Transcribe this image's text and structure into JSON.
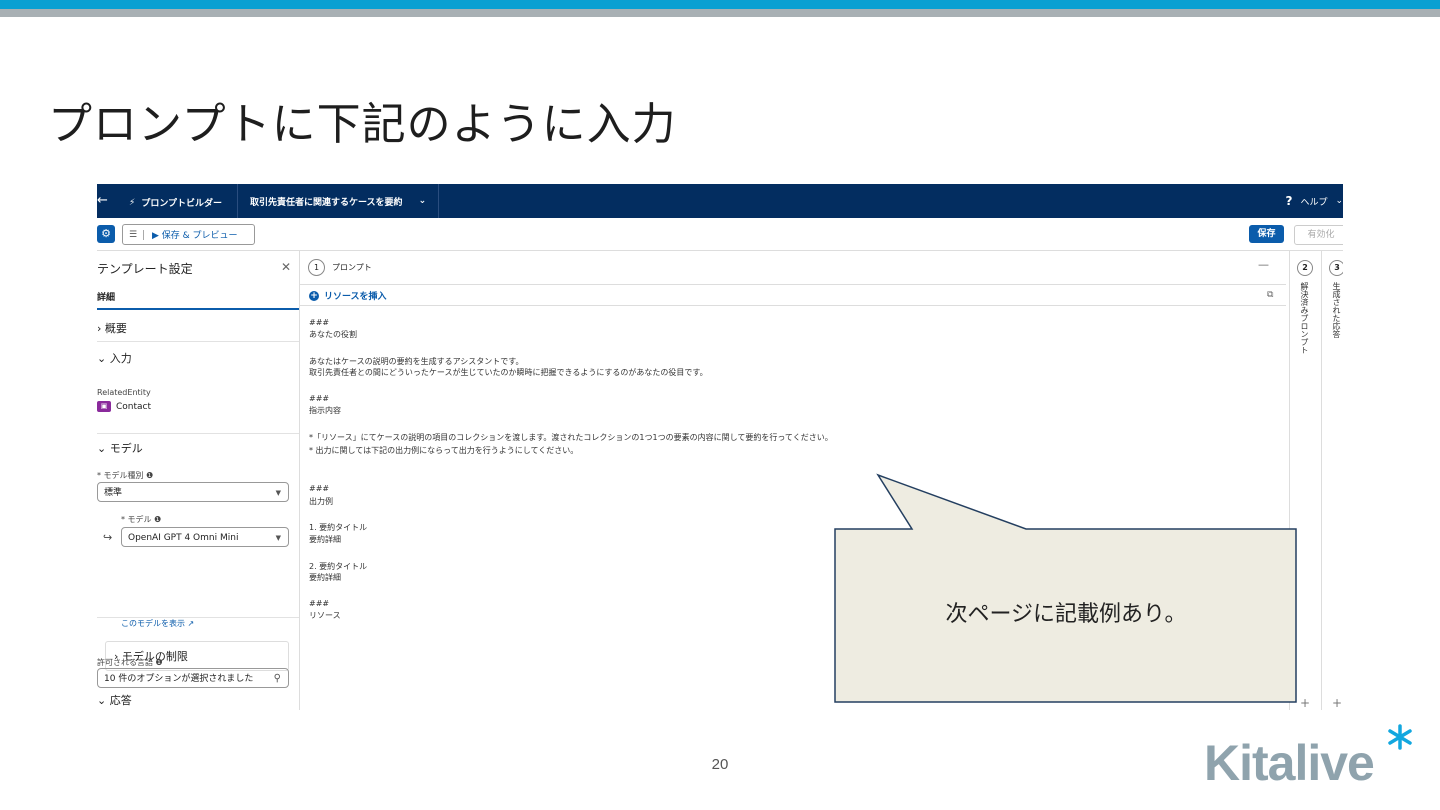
{
  "slide": {
    "title": "プロンプトに下記のように入力",
    "page_number": "20",
    "logo_text": "Kitalive",
    "colors": {
      "top_bar": "#0aa0d2",
      "top_bar_secondary": "#a8b0b4",
      "logo": "#8fa3ad",
      "logo_accent": "#12a7df"
    }
  },
  "app": {
    "nav": {
      "back_icon": "arrow-left-icon",
      "app_name": "プロンプトビルダー",
      "tab_label": "取引先責任者に関連するケースを要約",
      "help_label": "ヘルプ"
    },
    "toolbar": {
      "preview_label": "保存 & プレビュー",
      "save_label": "保存",
      "activate_label": "有効化"
    },
    "left_panel": {
      "title": "テンプレート設定",
      "tab": "詳細",
      "summary": "概要",
      "input": "入力",
      "related_entity_label": "RelatedEntity",
      "contact": "Contact",
      "model_section": "モデル",
      "model_type_label": "* モデル種別",
      "model_type_value": "標準",
      "model_label": "* モデル",
      "model_value": "OpenAI GPT 4 Omni Mini",
      "model_link": "このモデルを表示",
      "model_limit": "モデルの制限",
      "response_section": "応答",
      "languages_label": "許可される言語",
      "languages_value": "10 件のオプションが選択されました"
    },
    "center": {
      "step_number": "1",
      "step_label": "プロンプト",
      "insert_resource": "リソースを挿入",
      "prompt_lines": [
        "###",
        "あなたの役割",
        "あなたはケースの説明の要約を生成するアシスタントです。",
        "取引先責任者との間にどういったケースが生じていたのか瞬時に把握できるようにするのがあなたの役目です。",
        "###",
        "指示内容",
        "*「リソース」にてケースの説明の項目のコレクションを渡します。渡されたコレクションの1つ1つの要素の内容に関して要約を行ってください。",
        "* 出力に関しては下記の出力例にならって出力を行うようにしてください。",
        "###",
        "出力例",
        "1. 要約タイトル",
        "要約詳細",
        "2. 要約タイトル",
        "要約詳細",
        "###",
        "リソース"
      ]
    },
    "right_columns": [
      {
        "number": "2",
        "label": "解決済みプロンプト"
      },
      {
        "number": "3",
        "label": "生成された応答"
      }
    ]
  },
  "callout": {
    "text": "次ページに記載例あり。",
    "fill": "#eeece1",
    "stroke": "#243f60"
  }
}
